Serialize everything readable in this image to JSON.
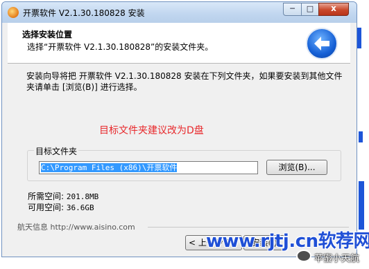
{
  "window": {
    "title": "开票软件 V2.1.30.180828 安装",
    "controls": {
      "minimize": "─",
      "maximize": "□",
      "close": "x"
    }
  },
  "header": {
    "title": "选择安装位置",
    "subtitle": "选择“开票软件 V2.1.30.180828”的安装文件夹。"
  },
  "body": {
    "description": "安装向导将把 开票软件 V2.1.30.180828 安装在下列文件夹，如果要安装到其他文件夹请单击 [浏览(B)] 进行选择。",
    "note": "目标文件夹建议改为D盘",
    "note_color": "#e8282b"
  },
  "target": {
    "group_label": "目标文件夹",
    "path_value": "C:\\Program Files (x86)\\开票软件",
    "browse_label": "浏览(B)..."
  },
  "space": {
    "required_label": "所需空间:",
    "required_value": "201.8MB",
    "available_label": "可用空间:",
    "available_value": "36.6GB"
  },
  "footer": {
    "brand": "航天信息 http://www.aisino.com",
    "back_label": "< 上一步(P)",
    "install_label": "安装(I)"
  },
  "watermark": {
    "site": "www.rjtj.cn软荐网",
    "account": "苹蜜小天航"
  },
  "colors": {
    "accent": "#1560d6",
    "watermark": "#1f4fd6"
  }
}
